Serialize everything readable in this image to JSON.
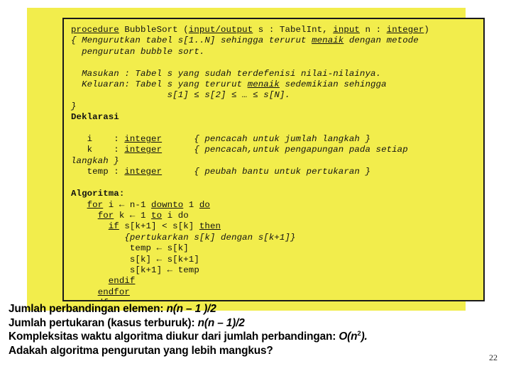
{
  "slide": {
    "page_number": "22",
    "panel_color": "#F2ED4C",
    "border_color": "#1a1a1a",
    "text_color": "#111111"
  },
  "code": {
    "title": "BubbleSort pseudocode",
    "signature": "procedure BubbleSort (input/output s : TabelInt, input n : integer)",
    "lines": [
      "procedure BubbleSort (input/output s : TabelInt, input n : integer)",
      "{ Mengurutkan tabel s[1..N] sehingga terurut menaik dengan metode",
      "  pengurutan bubble sort.",
      "",
      "  Masukan : Tabel s yang sudah terdefenisi nilai-nilainya.",
      "  Keluaran: Tabel s yang terurut menaik sedemikian sehingga",
      "                  s[1] ≤ s[2] ≤ … ≤ s[N].",
      "}",
      "Deklarasi",
      "",
      "   i    : integer      { pencacah untuk jumlah langkah }",
      "   k    : integer      { pencacah,untuk pengapungan pada setiap",
      "langkah }",
      "   temp : integer      { peubah bantu untuk pertukaran }",
      "",
      "Algoritma:",
      "   for i ← n-1 downto 1 do",
      "     for k ← 1 to i do",
      "       if s[k+1] < s[k] then",
      "          {pertukarkan s[k] dengan s[k+1]}",
      "           temp ← s[k]",
      "           s[k] ← s[k+1]",
      "           s[k+1] ← temp",
      "       endif",
      "     endfor",
      "   endfor"
    ],
    "keywords": [
      "procedure",
      "input/output",
      "input",
      "integer",
      "menaik",
      "for",
      "downto",
      "do",
      "to",
      "if",
      "then",
      "endif",
      "endfor"
    ],
    "section_headings": [
      "Deklarasi",
      "Algoritma:"
    ]
  },
  "summary": {
    "line1_prefix": "Jumlah perbandingan elemen: ",
    "line1_formula_var": "n",
    "line1_formula_rest": "(n – 1 )/2",
    "line2_prefix": "Jumlah pertukaran (kasus terburuk): ",
    "line2_formula_var": "n",
    "line2_formula_rest": "(n – 1)/2",
    "line3_prefix": "Kompleksitas waktu algoritma diukur dari jumlah perbandingan: ",
    "line3_bigo": "O(",
    "line3_bigo_var": "n",
    "line3_bigo_sup": "2",
    "line3_bigo_close": ").",
    "line4": "Adakah algoritma pengurutan yang lebih mangkus?"
  }
}
